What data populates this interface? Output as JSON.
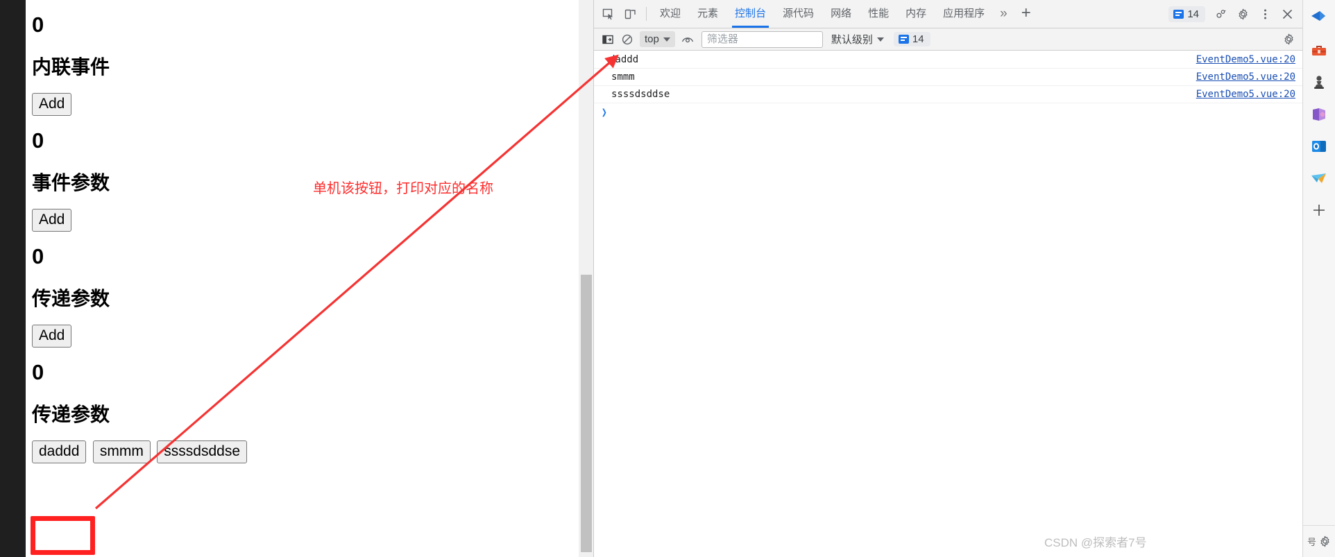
{
  "page": {
    "sections": [
      {
        "count": "0",
        "title": "内联事件",
        "buttons": [
          "Add"
        ]
      },
      {
        "count": "0",
        "title": "事件参数",
        "buttons": [
          "Add"
        ]
      },
      {
        "count": "0",
        "title": "传递参数",
        "buttons": [
          "Add"
        ]
      },
      {
        "count": "0",
        "title": "传递参数",
        "buttons": [
          "daddd",
          "smmm",
          "ssssdsddse"
        ]
      }
    ]
  },
  "annotation": {
    "text": "单机该按钮，打印对应的名称",
    "color": "#ff2d2d",
    "highlight_color": "#ff2020",
    "arrow_color": "#f53333"
  },
  "devtools": {
    "tabs": [
      {
        "label": "欢迎",
        "active": false
      },
      {
        "label": "元素",
        "active": false
      },
      {
        "label": "控制台",
        "active": true
      },
      {
        "label": "源代码",
        "active": false
      },
      {
        "label": "网络",
        "active": false
      },
      {
        "label": "性能",
        "active": false
      },
      {
        "label": "内存",
        "active": false
      },
      {
        "label": "应用程序",
        "active": false
      }
    ],
    "more_tabs_label": "»",
    "add_tab_label": "+",
    "issues_badge": "14",
    "accent_color": "#1a73e8",
    "console_toolbar": {
      "context": "top",
      "filter_placeholder": "筛选器",
      "filter_value": "",
      "level": "默认级别",
      "message_count": "14"
    },
    "console_messages": [
      {
        "text": "daddd",
        "source": "EventDemo5.vue:20"
      },
      {
        "text": "smmm",
        "source": "EventDemo5.vue:20"
      },
      {
        "text": "ssssdsddse",
        "source": "EventDemo5.vue:20"
      }
    ],
    "prompt_symbol": "❯"
  },
  "watermark": "CSDN @探索者7号",
  "taskbar": {
    "items": [
      "blue-arrow-icon",
      "toolbox-icon",
      "chess-pawn-icon",
      "purple-app-icon",
      "outlook-icon",
      "paper-plane-icon",
      "add-icon"
    ],
    "status_text": "号"
  }
}
